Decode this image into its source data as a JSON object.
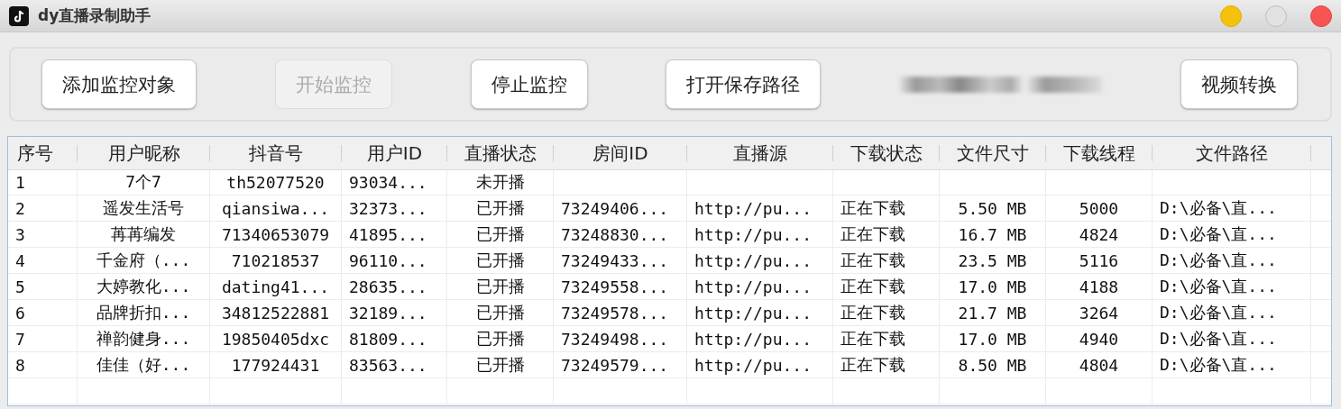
{
  "window": {
    "title": "dy直播录制助手"
  },
  "toolbar": {
    "buttons": [
      {
        "label": "添加监控对象",
        "disabled": false
      },
      {
        "label": "开始监控",
        "disabled": true
      },
      {
        "label": "停止监控",
        "disabled": false
      },
      {
        "label": "打开保存路径",
        "disabled": false
      },
      {
        "label": "视频转换",
        "disabled": false
      }
    ]
  },
  "table": {
    "columns": [
      "序号",
      "用户昵称",
      "抖音号",
      "用户ID",
      "直播状态",
      "房间ID",
      "直播源",
      "下载状态",
      "文件尺寸",
      "下载线程",
      "文件路径"
    ],
    "rows": [
      [
        "1",
        "7个7",
        "th52077520",
        "93034...",
        "未开播",
        null,
        null,
        null,
        null,
        null,
        null
      ],
      [
        "2",
        "遥发生活号",
        "qiansiwa...",
        "32373...",
        "已开播",
        "73249406...",
        "http://pu...",
        "正在下载",
        "5.50 MB",
        "5000",
        "D:\\必备\\直..."
      ],
      [
        "3",
        "苒苒编发",
        "71340653079",
        "41895...",
        "已开播",
        "73248830...",
        "http://pu...",
        "正在下载",
        "16.7 MB",
        "4824",
        "D:\\必备\\直..."
      ],
      [
        "4",
        "千金府（...",
        "710218537",
        "96110...",
        "已开播",
        "73249433...",
        "http://pu...",
        "正在下载",
        "23.5 MB",
        "5116",
        "D:\\必备\\直..."
      ],
      [
        "5",
        "大婷教化...",
        "dating41...",
        "28635...",
        "已开播",
        "73249558...",
        "http://pu...",
        "正在下载",
        "17.0 MB",
        "4188",
        "D:\\必备\\直..."
      ],
      [
        "6",
        "品牌折扣...",
        "34812522881",
        "32189...",
        "已开播",
        "73249578...",
        "http://pu...",
        "正在下载",
        "21.7 MB",
        "3264",
        "D:\\必备\\直..."
      ],
      [
        "7",
        "禅韵健身...",
        "19850405dxc",
        "81809...",
        "已开播",
        "73249498...",
        "http://pu...",
        "正在下载",
        "17.0 MB",
        "4940",
        "D:\\必备\\直..."
      ],
      [
        "8",
        "佳佳（好...",
        "177924431",
        "83563...",
        "已开播",
        "73249579...",
        "http://pu...",
        "正在下载",
        "8.50 MB",
        "4804",
        "D:\\必备\\直..."
      ]
    ]
  }
}
